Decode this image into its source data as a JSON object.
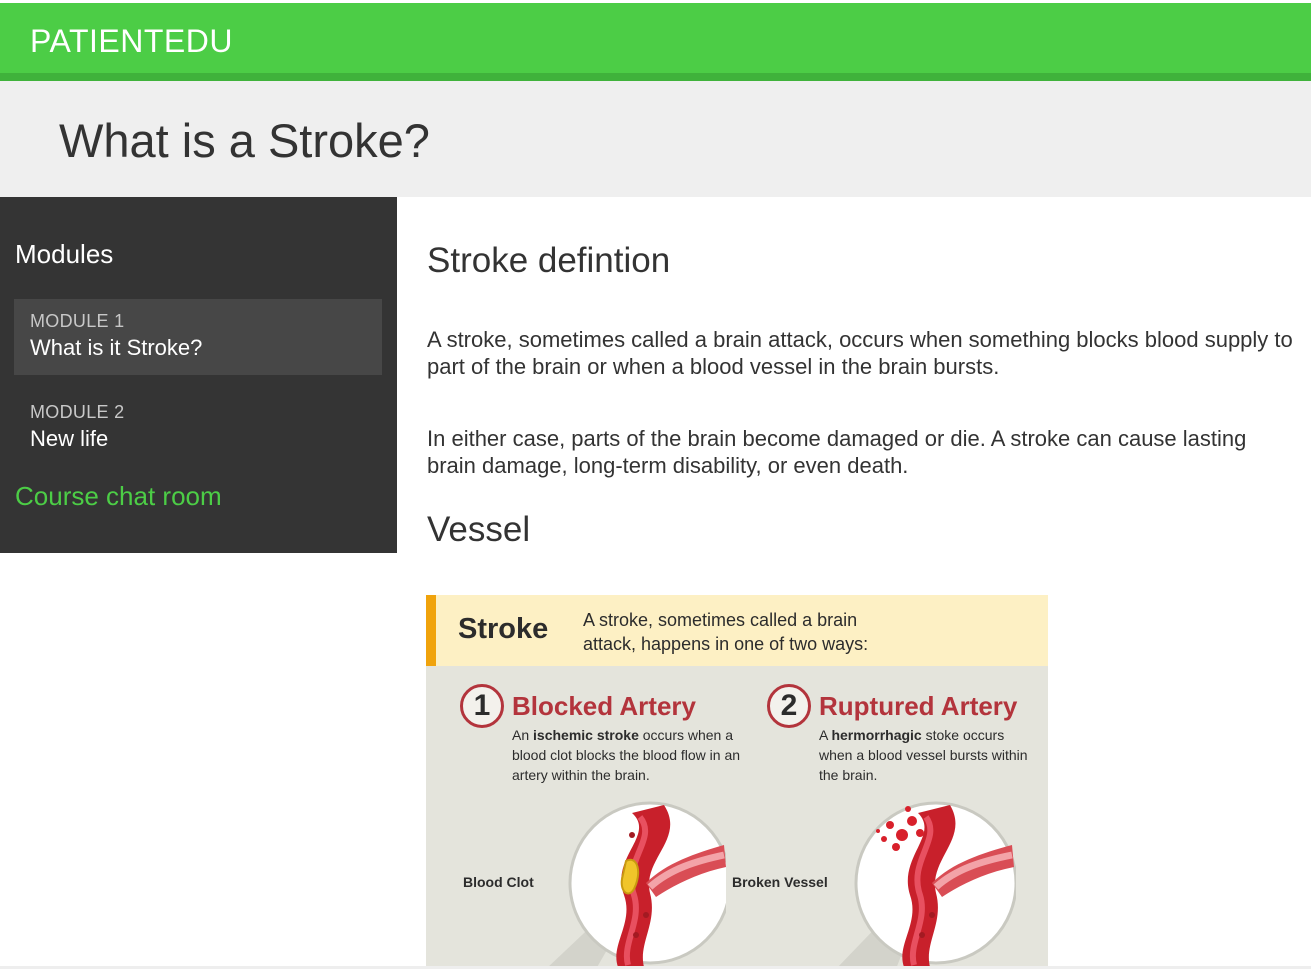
{
  "brand": "PATIENTEDU",
  "page": {
    "title": "What is a Stroke?"
  },
  "sidebar": {
    "heading": "Modules",
    "modules": [
      {
        "number": "MODULE 1",
        "title": "What is it Stroke?",
        "active": true
      },
      {
        "number": "MODULE 2",
        "title": "New life",
        "active": false
      }
    ],
    "chat_link": "Course chat room"
  },
  "content": {
    "section1_title": "Stroke defintion",
    "paragraph1": "A stroke, sometimes called a brain attack, occurs when something blocks blood supply to part of the brain or when a blood vessel in the brain bursts.",
    "paragraph2": "In either case, parts of the brain become damaged or die. A stroke can cause lasting brain damage, long-term disability, or even death.",
    "section2_title": "Vessel"
  },
  "infographic": {
    "title": "Stroke",
    "intro": "A stroke, sometimes called a brain attack, happens in one of two ways:",
    "ways": [
      {
        "number": "1",
        "title": "Blocked Artery",
        "desc_pre": "An ",
        "desc_bold": "ischemic stroke",
        "desc_post": " occurs when a blood clot blocks the blood flow in an artery within the brain.",
        "label": "Blood Clot"
      },
      {
        "number": "2",
        "title": "Ruptured Artery",
        "desc_pre": "A ",
        "desc_bold": "hermorrhagic",
        "desc_post": " stoke occurs when a blood vessel bursts within the brain.",
        "label": "Broken Vessel"
      }
    ]
  },
  "colors": {
    "brand_green": "#4ccd46",
    "sidebar_bg": "#343434",
    "accent_red": "#b3343c",
    "accent_orange": "#f0a30c"
  }
}
